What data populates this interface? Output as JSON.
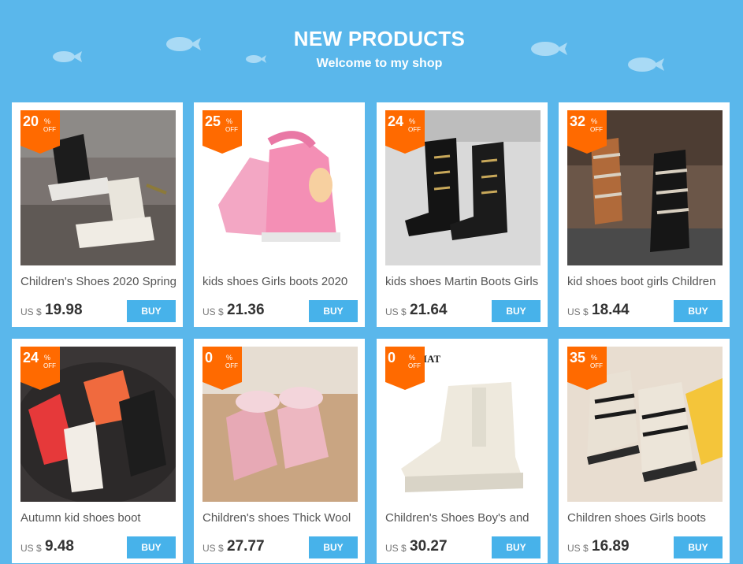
{
  "header": {
    "title": "NEW PRODUCTS",
    "subtitle": "Welcome to my shop"
  },
  "colors": {
    "background": "#5ab7eb",
    "badge": "#ff6a00",
    "buy_button": "#47b2ea"
  },
  "products": [
    {
      "discount": "20",
      "pct": "%",
      "off": "OFF",
      "name": "Children's Shoes 2020 Spring",
      "currency": "US $",
      "price": "19.98",
      "buy": "BUY",
      "image": "black-white-kids-boots-photo"
    },
    {
      "discount": "25",
      "pct": "%",
      "off": "OFF",
      "name": "kids shoes Girls boots 2020",
      "currency": "US $",
      "price": "21.36",
      "buy": "BUY",
      "image": "pink-snow-boots-photo"
    },
    {
      "discount": "24",
      "pct": "%",
      "off": "OFF",
      "name": "kids shoes Martin Boots Girls",
      "currency": "US $",
      "price": "21.64",
      "buy": "BUY",
      "image": "black-knee-high-martin-boots-photo"
    },
    {
      "discount": "32",
      "pct": "%",
      "off": "OFF",
      "name": "kid shoes boot girls Children",
      "currency": "US $",
      "price": "18.44",
      "buy": "BUY",
      "image": "striped-brown-black-boots-photo"
    },
    {
      "discount": "24",
      "pct": "%",
      "off": "OFF",
      "name": "Autumn kid shoes boot",
      "currency": "US $",
      "price": "9.48",
      "buy": "BUY",
      "image": "red-white-black-boots-photo"
    },
    {
      "discount": "0",
      "pct": "%",
      "off": "OFF",
      "name": "Children's shoes Thick Wool",
      "currency": "US $",
      "price": "27.77",
      "buy": "BUY",
      "image": "pink-fur-boots-photo"
    },
    {
      "discount": "0",
      "pct": "%",
      "off": "OFF",
      "name": "Children's Shoes Boy's and",
      "currency": "US $",
      "price": "30.27",
      "buy": "BUY",
      "image": "cream-chelsea-boot-photo",
      "image_text": "IAT"
    },
    {
      "discount": "35",
      "pct": "%",
      "off": "OFF",
      "name": "Children shoes Girls boots",
      "currency": "US $",
      "price": "16.89",
      "buy": "BUY",
      "image": "beige-lace-up-boots-photo"
    }
  ]
}
